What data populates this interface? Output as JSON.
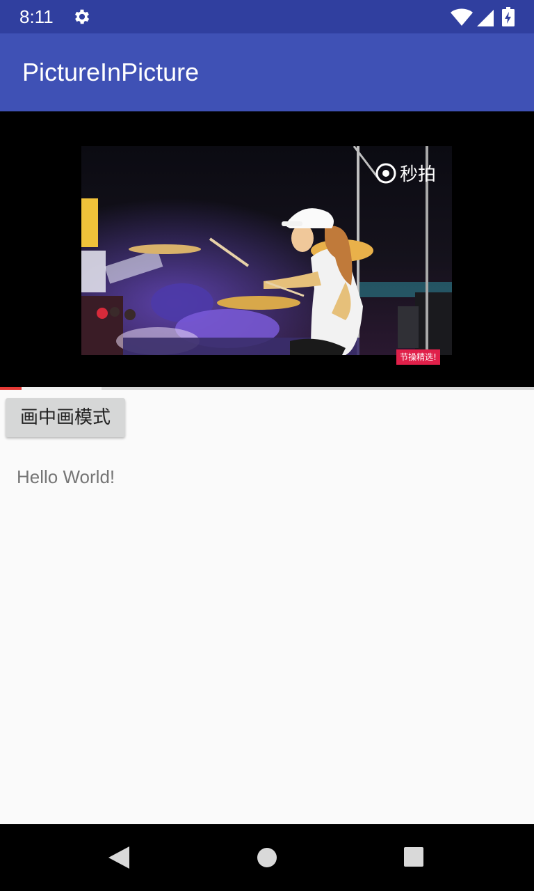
{
  "status_bar": {
    "time": "8:11",
    "icons": [
      "gear-icon",
      "wifi-icon",
      "cell-signal-icon",
      "battery-charging-icon"
    ]
  },
  "app_bar": {
    "title": "PictureInPicture",
    "color": "#3f51b5"
  },
  "video": {
    "watermark_top": "秒拍",
    "watermark_bottom": "节操精选!",
    "progress_played": 0.04,
    "progress_buffered": 0.19
  },
  "content": {
    "pip_button_label": "画中画模式",
    "hello_text": "Hello World!"
  },
  "nav_bar": {
    "icons": [
      "back-icon",
      "home-icon",
      "recents-icon"
    ]
  },
  "colors": {
    "status_bar": "#303f9f",
    "primary": "#3f51b5",
    "progress": "#e53935"
  }
}
